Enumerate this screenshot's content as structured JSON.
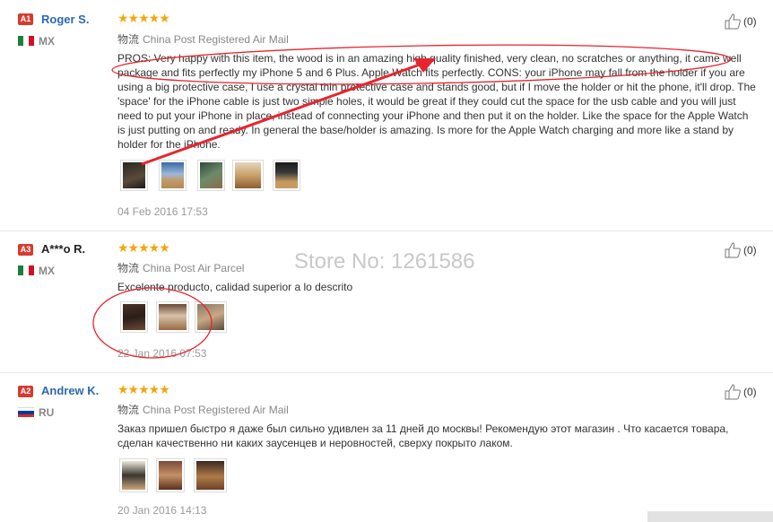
{
  "watermark": "Store No: 1261586",
  "reviews": [
    {
      "level": "A1",
      "name": "Roger S.",
      "country": "MX",
      "stars": "★★★★★",
      "ship_cn": "物流",
      "shipping": "China Post Registered Air Mail",
      "text": "PROS: Very happy with this item, the wood is in an amazing high quality finished, very clean, no scratches or anything, it came well package and fits perfectly my iPhone 5 and 6 Plus. Apple Watch fits perfectly. CONS: your iPhone may fall from the holder if you are using a big protective case, I use a crystal thin protective case and stands good, but if I move the holder or hit the phone, it'll drop. The 'space' for the iPhone cable is just two simple holes, it would be great if they could cut the space for the usb cable and you will just need to put your iPhone in place, instead of connecting your iPhone and then put it on the holder. Like the space for the Apple Watch is just putting on and ready. In general the base/holder is amazing. Is more for the Apple Watch charging and more like a stand by holder for the iPhone.",
      "date": "04 Feb 2016 17:53",
      "likes": "(0)"
    },
    {
      "level": "A3",
      "name": "A***o R.",
      "country": "MX",
      "stars": "★★★★★",
      "ship_cn": "物流",
      "shipping": "China Post Air Parcel",
      "text": "Excelente producto, calidad superior a lo descrito",
      "date": "22 Jan 2016 07:53",
      "likes": "(0)"
    },
    {
      "level": "A2",
      "name": "Andrew K.",
      "country": "RU",
      "stars": "★★★★★",
      "ship_cn": "物流",
      "shipping": "China Post Registered Air Mail",
      "text": "Заказ пришел быстро я даже был сильно удивлен за 11 дней до москвы! Рекомендую этот магазин . Что касается товара, сделан качественно ни каких заусенцев и неровностей, сверху покрыто лаком.",
      "date": "20 Jan 2016 14:13",
      "likes": "(0)"
    }
  ],
  "colors": {
    "link": "#2b68b5",
    "star": "#f2a60f",
    "level_badge": "#d63b2f",
    "annotation_red": "#e8242e"
  },
  "icons": [
    "thumbs-up-icon",
    "flag-icon",
    "star-icon"
  ]
}
